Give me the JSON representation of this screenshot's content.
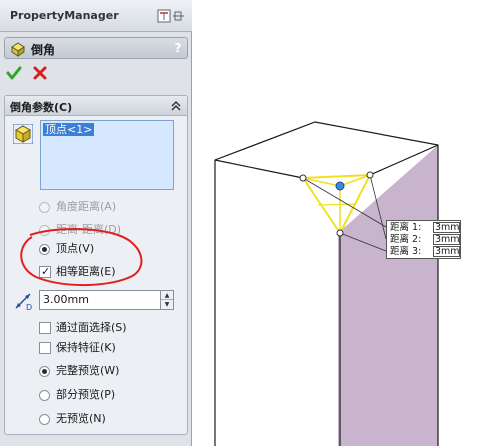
{
  "property_manager": {
    "title": "PropertyManager",
    "pin_icon": "pin-icon"
  },
  "feature": {
    "title": "倒角",
    "icon": "chamfer-icon",
    "help": "?"
  },
  "actions": {
    "ok_icon": "checkmark-icon",
    "ok_color": "#2ea32e",
    "cancel_icon": "x-icon",
    "cancel_color": "#d32020"
  },
  "chamfer_params": {
    "title": "倒角参数(C)",
    "selection_items": [
      "顶点<1>"
    ],
    "options": {
      "angle_distance": "角度距离(A)",
      "distance_distance": "距离-距离(D)",
      "vertex": "顶点(V)",
      "equal_distance": "相等距离(E)"
    },
    "selected_type": "vertex",
    "equal_distance_checked": true,
    "distance_value": "3.00mm",
    "select_through_faces": "通过面选择(S)",
    "select_through_faces_checked": false,
    "keep_features": "保持特征(K)",
    "keep_features_checked": false,
    "preview": {
      "full": "完整预览(W)",
      "partial": "部分预览(P)",
      "none": "无预览(N)",
      "selected": "full"
    }
  },
  "callout": {
    "rows": [
      {
        "label": "距离 1:",
        "value": "3mm"
      },
      {
        "label": "距离 2:",
        "value": "3mm"
      },
      {
        "label": "距离 3:",
        "value": "3mm"
      }
    ]
  },
  "colors": {
    "side_face": "#c8b4cc",
    "preview_lines": "#f0e020",
    "annotation": "#e02020",
    "selection_highlight": "#3b7fd6"
  }
}
